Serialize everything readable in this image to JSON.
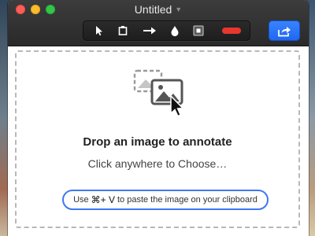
{
  "window": {
    "title": "Untitled"
  },
  "toolbar": {
    "tools": [
      {
        "name": "select-tool",
        "icon": "arrow-pointer-icon"
      },
      {
        "name": "crop-tool",
        "icon": "crop-icon"
      },
      {
        "name": "arrow-tool",
        "icon": "right-arrow-icon"
      },
      {
        "name": "blur-tool",
        "icon": "drop-icon"
      },
      {
        "name": "rectangle-tool",
        "icon": "square-icon"
      }
    ],
    "color_swatch": "#e8372f",
    "share_icon": "share-icon",
    "accent": "#2f74ff"
  },
  "dropzone": {
    "headline": "Drop an image to annotate",
    "subline": "Click anywhere to Choose…",
    "hint_before": "Use",
    "hint_keys": "⌘+ V",
    "hint_after": "to paste the image on your clipboard"
  }
}
